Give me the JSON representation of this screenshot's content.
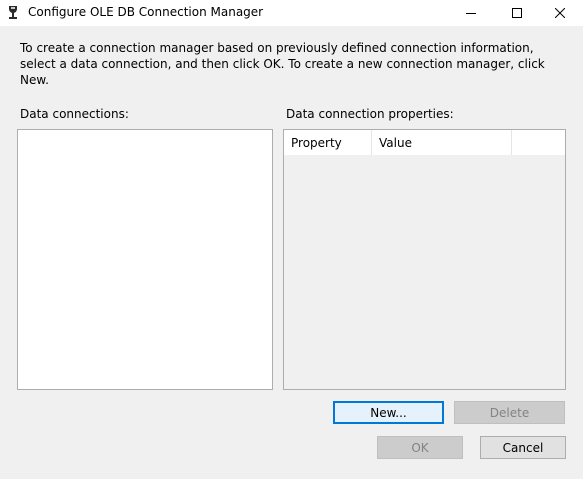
{
  "window": {
    "title": "Configure OLE DB Connection Manager",
    "icons": {
      "app": "ssis-app-icon",
      "minimize": "minimize-icon",
      "maximize": "maximize-icon",
      "close": "close-icon"
    }
  },
  "intro_text": "To create a connection manager based on previously defined connection information, select a data connection, and then click OK. To create a new connection manager, click New.",
  "data_connections": {
    "label": "Data connections:",
    "items": []
  },
  "properties": {
    "label": "Data connection properties:",
    "columns": [
      "Property",
      "Value"
    ]
  },
  "buttons": {
    "new": "New...",
    "delete": "Delete",
    "ok": "OK",
    "cancel": "Cancel"
  }
}
